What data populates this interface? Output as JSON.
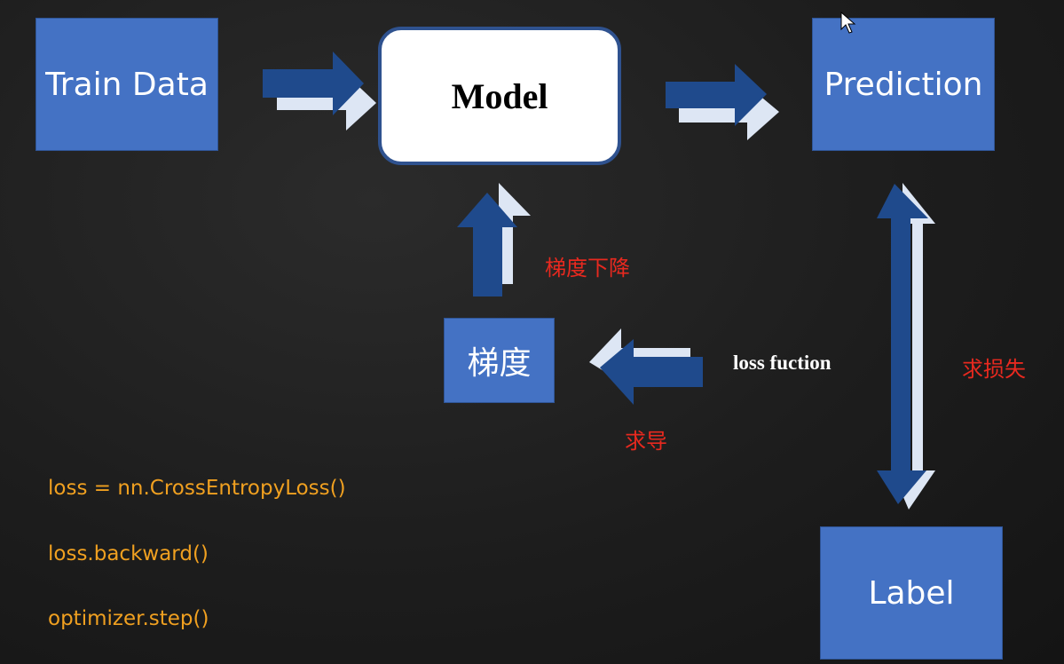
{
  "nodes": {
    "train_data": "Train Data",
    "model": "Model",
    "prediction": "Prediction",
    "label": "Label",
    "gradient": "梯度"
  },
  "edge_labels": {
    "gradient_descent": "梯度下降",
    "derivative": "求导",
    "loss_function": "loss fuction",
    "compute_loss": "求损失"
  },
  "code_lines": [
    "loss = nn.CrossEntropyLoss()",
    "loss.backward()",
    "optimizer.step()"
  ],
  "colors": {
    "box_fill": "#4472c4",
    "arrow_dark": "#1f4a8c",
    "arrow_light": "#dde6f4",
    "red_label": "#e8291f",
    "code_text": "#f0a020"
  },
  "icons": [
    "arrow-right-icon",
    "arrow-up-icon",
    "arrow-left-icon",
    "double-arrow-vertical-icon",
    "mouse-cursor-icon"
  ]
}
